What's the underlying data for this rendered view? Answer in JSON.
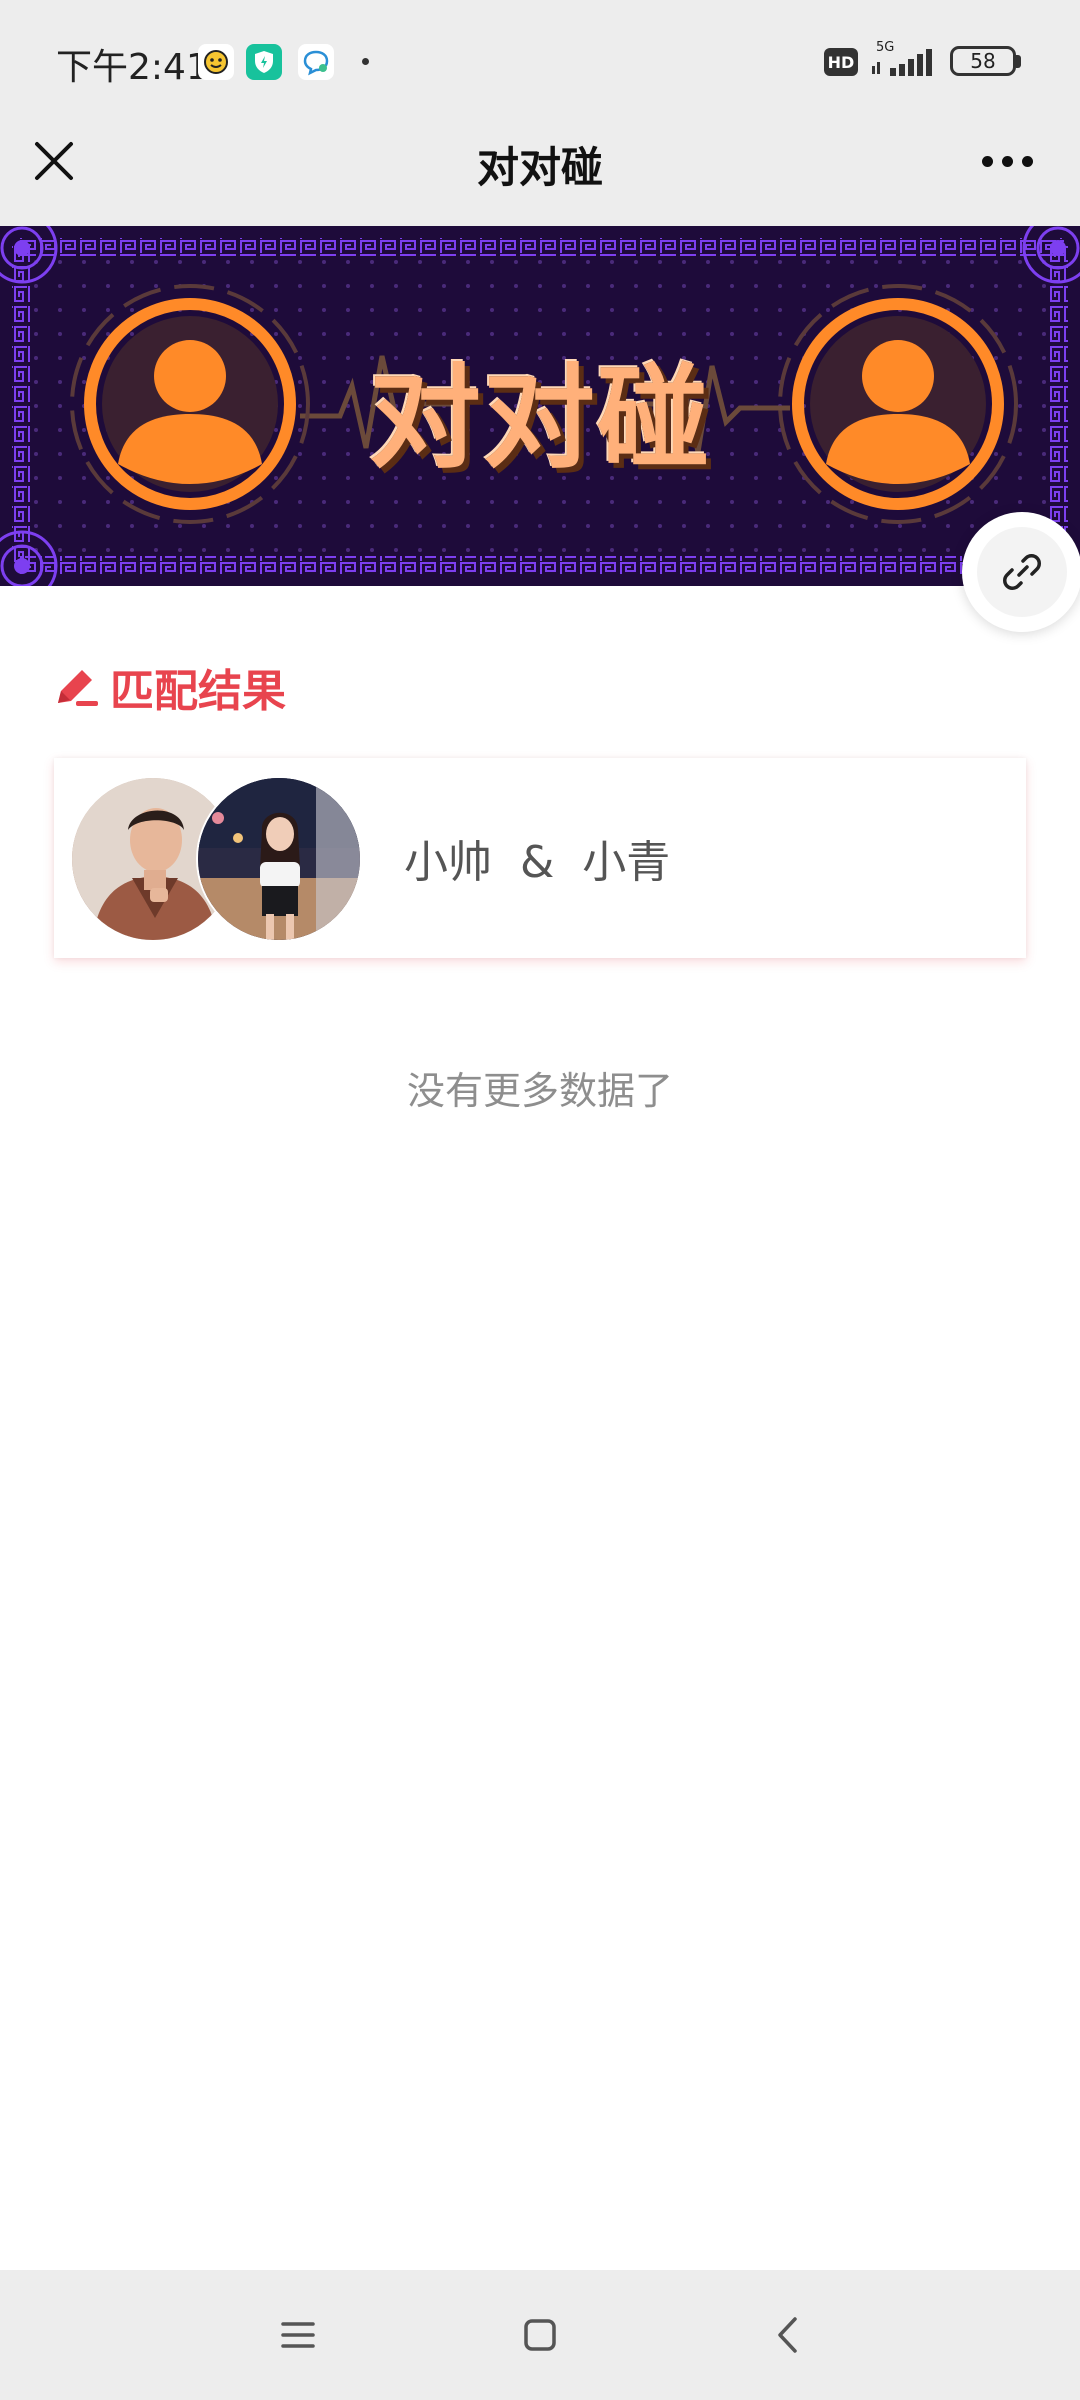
{
  "status_bar": {
    "time": "下午2:41",
    "network": "5G",
    "hd": "HD",
    "battery": "58",
    "app_icons": [
      "emoji-app-icon",
      "security-app-icon",
      "chat-app-icon"
    ]
  },
  "header": {
    "title": "对对碰"
  },
  "banner": {
    "title": "对对碰",
    "colors": {
      "background": "#1e0b3a",
      "accent": "#ff8a28",
      "border": "#6b2fd0",
      "text": "#ffb07a"
    }
  },
  "section": {
    "title": "匹配结果",
    "color": "#e8444e"
  },
  "matches": [
    {
      "name_a": "小帅",
      "separator": "&",
      "name_b": "小青"
    }
  ],
  "footer": {
    "no_more_text": "没有更多数据了"
  }
}
